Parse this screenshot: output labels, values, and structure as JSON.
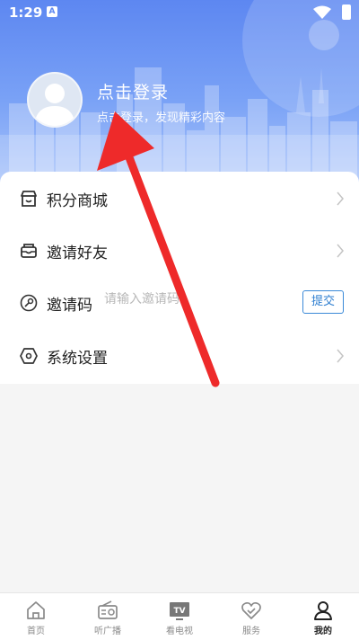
{
  "status_bar": {
    "time": "1:29",
    "notification_badge": "A"
  },
  "profile": {
    "title": "点击登录",
    "subtitle": "点击登录，发现精彩内容"
  },
  "menu": {
    "items": [
      {
        "label": "积分商城",
        "icon": "shop-icon"
      },
      {
        "label": "邀请好友",
        "icon": "inbox-icon"
      },
      {
        "label": "邀请码",
        "icon": "key-icon",
        "placeholder": "请输入邀请码",
        "button": "提交"
      },
      {
        "label": "系统设置",
        "icon": "settings-icon"
      }
    ]
  },
  "bottom_nav": {
    "items": [
      {
        "label": "首页",
        "icon": "home-icon"
      },
      {
        "label": "听广播",
        "icon": "radio-icon"
      },
      {
        "label": "看电视",
        "icon": "tv-icon",
        "badge": "TV"
      },
      {
        "label": "服务",
        "icon": "service-icon"
      },
      {
        "label": "我的",
        "icon": "user-icon",
        "active": true
      }
    ]
  },
  "colors": {
    "header_top": "#5d87f1",
    "accent_blue": "#2f7fd0",
    "annotation_red": "#ee2a2a"
  }
}
